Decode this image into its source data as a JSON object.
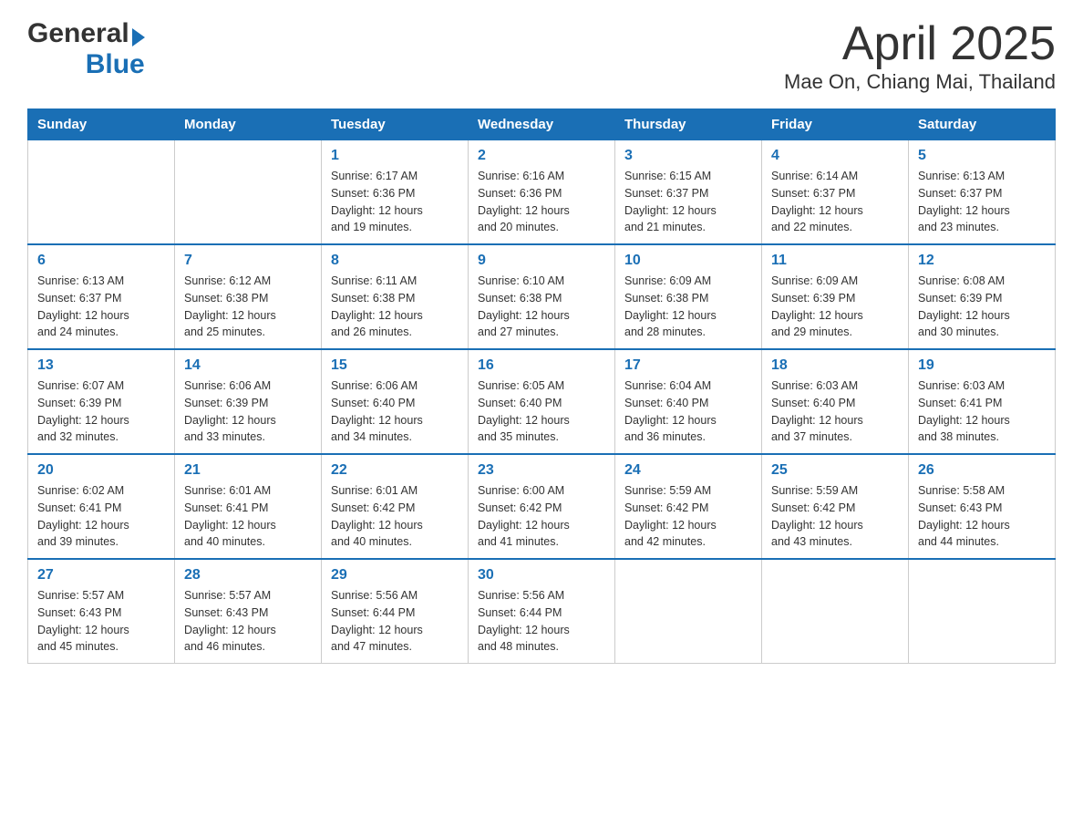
{
  "header": {
    "logo_general": "General",
    "logo_blue": "Blue",
    "title": "April 2025",
    "subtitle": "Mae On, Chiang Mai, Thailand"
  },
  "calendar": {
    "days_of_week": [
      "Sunday",
      "Monday",
      "Tuesday",
      "Wednesday",
      "Thursday",
      "Friday",
      "Saturday"
    ],
    "weeks": [
      [
        {
          "day": "",
          "info": ""
        },
        {
          "day": "",
          "info": ""
        },
        {
          "day": "1",
          "info": "Sunrise: 6:17 AM\nSunset: 6:36 PM\nDaylight: 12 hours\nand 19 minutes."
        },
        {
          "day": "2",
          "info": "Sunrise: 6:16 AM\nSunset: 6:36 PM\nDaylight: 12 hours\nand 20 minutes."
        },
        {
          "day": "3",
          "info": "Sunrise: 6:15 AM\nSunset: 6:37 PM\nDaylight: 12 hours\nand 21 minutes."
        },
        {
          "day": "4",
          "info": "Sunrise: 6:14 AM\nSunset: 6:37 PM\nDaylight: 12 hours\nand 22 minutes."
        },
        {
          "day": "5",
          "info": "Sunrise: 6:13 AM\nSunset: 6:37 PM\nDaylight: 12 hours\nand 23 minutes."
        }
      ],
      [
        {
          "day": "6",
          "info": "Sunrise: 6:13 AM\nSunset: 6:37 PM\nDaylight: 12 hours\nand 24 minutes."
        },
        {
          "day": "7",
          "info": "Sunrise: 6:12 AM\nSunset: 6:38 PM\nDaylight: 12 hours\nand 25 minutes."
        },
        {
          "day": "8",
          "info": "Sunrise: 6:11 AM\nSunset: 6:38 PM\nDaylight: 12 hours\nand 26 minutes."
        },
        {
          "day": "9",
          "info": "Sunrise: 6:10 AM\nSunset: 6:38 PM\nDaylight: 12 hours\nand 27 minutes."
        },
        {
          "day": "10",
          "info": "Sunrise: 6:09 AM\nSunset: 6:38 PM\nDaylight: 12 hours\nand 28 minutes."
        },
        {
          "day": "11",
          "info": "Sunrise: 6:09 AM\nSunset: 6:39 PM\nDaylight: 12 hours\nand 29 minutes."
        },
        {
          "day": "12",
          "info": "Sunrise: 6:08 AM\nSunset: 6:39 PM\nDaylight: 12 hours\nand 30 minutes."
        }
      ],
      [
        {
          "day": "13",
          "info": "Sunrise: 6:07 AM\nSunset: 6:39 PM\nDaylight: 12 hours\nand 32 minutes."
        },
        {
          "day": "14",
          "info": "Sunrise: 6:06 AM\nSunset: 6:39 PM\nDaylight: 12 hours\nand 33 minutes."
        },
        {
          "day": "15",
          "info": "Sunrise: 6:06 AM\nSunset: 6:40 PM\nDaylight: 12 hours\nand 34 minutes."
        },
        {
          "day": "16",
          "info": "Sunrise: 6:05 AM\nSunset: 6:40 PM\nDaylight: 12 hours\nand 35 minutes."
        },
        {
          "day": "17",
          "info": "Sunrise: 6:04 AM\nSunset: 6:40 PM\nDaylight: 12 hours\nand 36 minutes."
        },
        {
          "day": "18",
          "info": "Sunrise: 6:03 AM\nSunset: 6:40 PM\nDaylight: 12 hours\nand 37 minutes."
        },
        {
          "day": "19",
          "info": "Sunrise: 6:03 AM\nSunset: 6:41 PM\nDaylight: 12 hours\nand 38 minutes."
        }
      ],
      [
        {
          "day": "20",
          "info": "Sunrise: 6:02 AM\nSunset: 6:41 PM\nDaylight: 12 hours\nand 39 minutes."
        },
        {
          "day": "21",
          "info": "Sunrise: 6:01 AM\nSunset: 6:41 PM\nDaylight: 12 hours\nand 40 minutes."
        },
        {
          "day": "22",
          "info": "Sunrise: 6:01 AM\nSunset: 6:42 PM\nDaylight: 12 hours\nand 40 minutes."
        },
        {
          "day": "23",
          "info": "Sunrise: 6:00 AM\nSunset: 6:42 PM\nDaylight: 12 hours\nand 41 minutes."
        },
        {
          "day": "24",
          "info": "Sunrise: 5:59 AM\nSunset: 6:42 PM\nDaylight: 12 hours\nand 42 minutes."
        },
        {
          "day": "25",
          "info": "Sunrise: 5:59 AM\nSunset: 6:42 PM\nDaylight: 12 hours\nand 43 minutes."
        },
        {
          "day": "26",
          "info": "Sunrise: 5:58 AM\nSunset: 6:43 PM\nDaylight: 12 hours\nand 44 minutes."
        }
      ],
      [
        {
          "day": "27",
          "info": "Sunrise: 5:57 AM\nSunset: 6:43 PM\nDaylight: 12 hours\nand 45 minutes."
        },
        {
          "day": "28",
          "info": "Sunrise: 5:57 AM\nSunset: 6:43 PM\nDaylight: 12 hours\nand 46 minutes."
        },
        {
          "day": "29",
          "info": "Sunrise: 5:56 AM\nSunset: 6:44 PM\nDaylight: 12 hours\nand 47 minutes."
        },
        {
          "day": "30",
          "info": "Sunrise: 5:56 AM\nSunset: 6:44 PM\nDaylight: 12 hours\nand 48 minutes."
        },
        {
          "day": "",
          "info": ""
        },
        {
          "day": "",
          "info": ""
        },
        {
          "day": "",
          "info": ""
        }
      ]
    ]
  }
}
